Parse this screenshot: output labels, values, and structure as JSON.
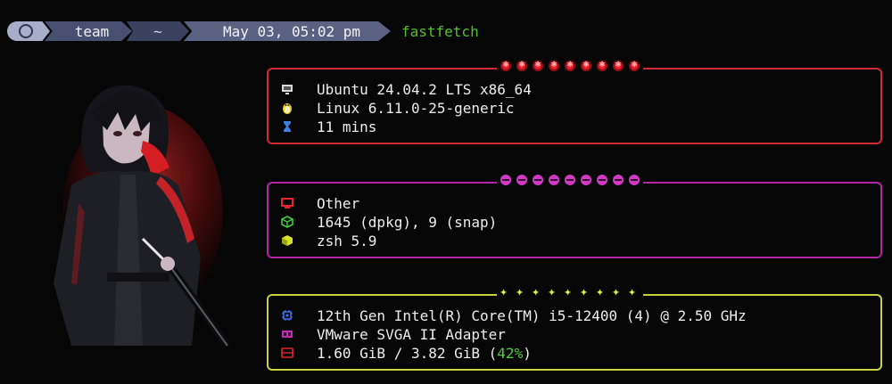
{
  "prompt": {
    "user": "team",
    "dir": "~",
    "datetime": "May 03, 05:02 pm",
    "command": "fastfetch"
  },
  "system": [
    {
      "icon": "monitor-icon",
      "value": "Ubuntu 24.04.2 LTS x86_64"
    },
    {
      "icon": "tux-icon",
      "value": "Linux 6.11.0-25-generic"
    },
    {
      "icon": "hourglass-icon",
      "value": "11 mins"
    }
  ],
  "software": [
    {
      "icon": "display-icon",
      "value": "Other"
    },
    {
      "icon": "package-icon",
      "value": "1645 (dpkg), 9 (snap)"
    },
    {
      "icon": "shell-icon",
      "value": "zsh 5.9"
    }
  ],
  "hardware": [
    {
      "icon": "cpu-icon",
      "value": "12th Gen Intel(R) Core(TM) i5-12400 (4) @ 2.50 GHz"
    },
    {
      "icon": "gpu-icon",
      "value": "VMware SVGA II Adapter"
    },
    {
      "icon": "memory-icon",
      "value": "1.60 GiB / 3.82 GiB (",
      "percent": "42%",
      "suffix": ")"
    }
  ],
  "colors": {
    "box_system": "#d12a32",
    "box_software": "#b225a6",
    "box_hardware": "#c9d23d",
    "command": "#52c22a",
    "percent": "#4fd03a"
  }
}
